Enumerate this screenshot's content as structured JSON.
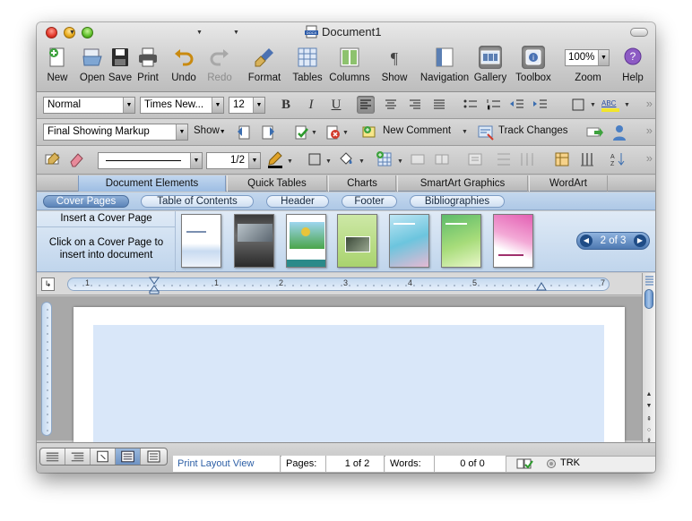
{
  "window": {
    "title": "Document1"
  },
  "standard_toolbar": {
    "items": [
      {
        "label": "New",
        "icon": "new-document-icon"
      },
      {
        "label": "Open",
        "icon": "open-folder-icon"
      },
      {
        "label": "Save",
        "icon": "save-disk-icon"
      },
      {
        "label": "Print",
        "icon": "printer-icon"
      },
      {
        "label": "Undo",
        "icon": "undo-icon"
      },
      {
        "label": "Redo",
        "icon": "redo-icon",
        "disabled": true
      },
      {
        "label": "Format",
        "icon": "format-brush-icon"
      },
      {
        "label": "Tables",
        "icon": "table-grid-icon"
      },
      {
        "label": "Columns",
        "icon": "columns-icon"
      },
      {
        "label": "Show",
        "icon": "pilcrow-icon"
      },
      {
        "label": "Navigation",
        "icon": "navigation-pane-icon"
      },
      {
        "label": "Gallery",
        "icon": "gallery-icon",
        "pressed": true
      },
      {
        "label": "Toolbox",
        "icon": "toolbox-icon",
        "pressed": true
      },
      {
        "label": "Zoom",
        "icon": "zoom-icon"
      },
      {
        "label": "Help",
        "icon": "help-icon"
      }
    ],
    "zoom_value": "100%"
  },
  "formatting_toolbar": {
    "style": "Normal",
    "font": "Times New...",
    "size": "12",
    "bold": "B",
    "italic": "I",
    "underline": "U",
    "highlight_sample": "ABC"
  },
  "review_toolbar": {
    "markup_view": "Final Showing Markup",
    "show_label": "Show",
    "new_comment": "New Comment",
    "track_changes": "Track Changes"
  },
  "tables_toolbar": {
    "line_weight": "1/2"
  },
  "elements_gallery": {
    "tabs": [
      "Document Elements",
      "Quick Tables",
      "Charts",
      "SmartArt Graphics",
      "WordArt"
    ],
    "active_tab": "Document Elements",
    "subtabs": [
      "Cover Pages",
      "Table of Contents",
      "Header",
      "Footer",
      "Bibliographies"
    ],
    "active_subtab": "Cover Pages",
    "insert_title": "Insert a Cover Page",
    "hint": "Click on a Cover Page to insert into document",
    "pager": "2 of 3"
  },
  "ruler": {
    "marks": [
      "1",
      "1",
      "2",
      "3",
      "4",
      "5",
      "7"
    ]
  },
  "status_bar": {
    "view_name": "Print Layout View",
    "pages_label": "Pages:",
    "pages_value": "1 of 2",
    "words_label": "Words:",
    "words_value": "0 of 0",
    "trk": "TRK"
  },
  "colors": {
    "accent_blue": "#5c84b8",
    "page_fill": "#d9e7f9"
  }
}
